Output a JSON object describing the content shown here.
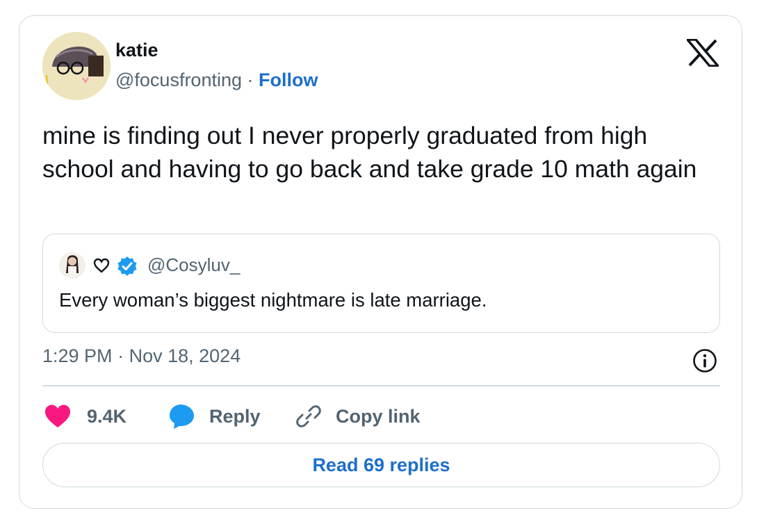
{
  "author": {
    "name": "katie",
    "handle": "@focusfronting",
    "separator": "·",
    "follow_label": "Follow"
  },
  "tweet": {
    "text": "mine is finding out I never properly graduated from high school and having to go back and take grade 10 math again"
  },
  "quoted": {
    "handle": "@Cosyluv_",
    "text": "Every woman’s biggest nightmare is late marriage."
  },
  "meta": {
    "time": "1:29 PM",
    "separator": "·",
    "date": "Nov 18, 2024"
  },
  "actions": {
    "likes": "9.4K",
    "reply_label": "Reply",
    "copy_label": "Copy link"
  },
  "read_replies_label": "Read 69 replies",
  "icons": {
    "brand": "x-logo-icon",
    "like": "heart-icon",
    "reply": "speech-bubble-icon",
    "copy": "link-icon",
    "info": "info-icon",
    "verified": "verified-badge-icon"
  },
  "colors": {
    "like": "#f91880",
    "reply": "#1d9bf0",
    "follow": "#1d6fc9",
    "verified": "#1d9bf0",
    "muted": "#536471",
    "border": "#cfd9de"
  }
}
